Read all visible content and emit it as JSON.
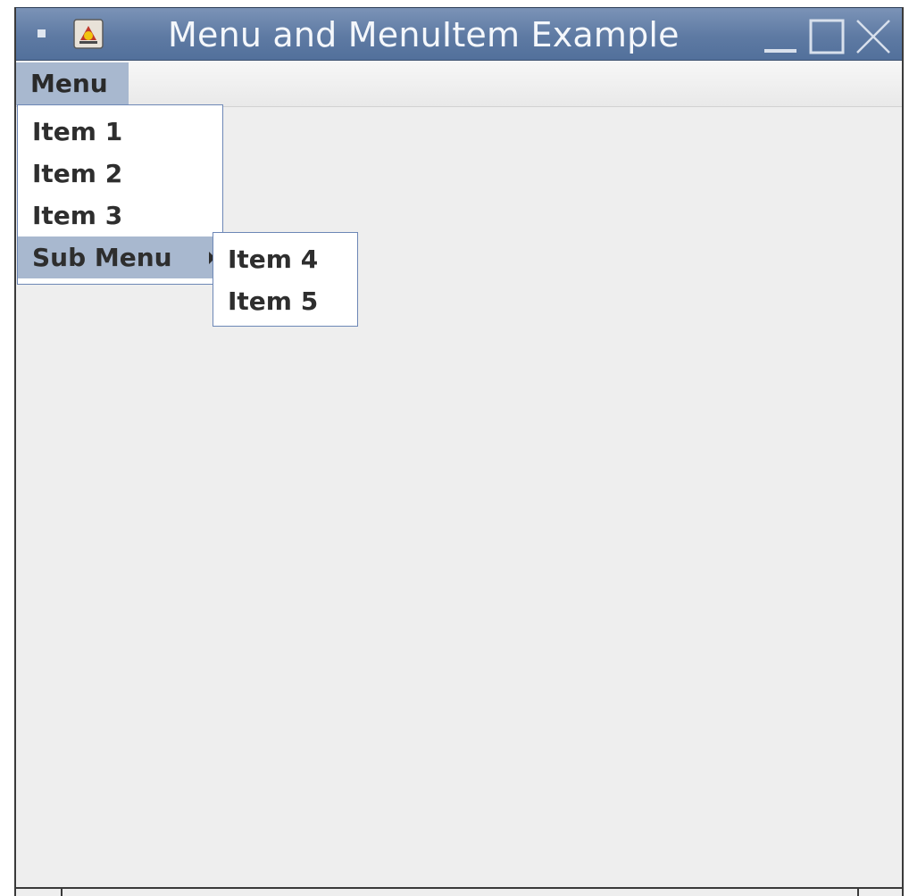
{
  "window": {
    "title": "Menu and MenuItem Example",
    "icon": "java-app-icon",
    "controls": [
      "minimize-icon",
      "maximize-icon",
      "close-icon"
    ]
  },
  "menubar": {
    "menu_label": "Menu"
  },
  "menu_popup": {
    "items": [
      {
        "label": "Item 1"
      },
      {
        "label": "Item 2"
      },
      {
        "label": "Item 3"
      },
      {
        "label": "Sub Menu",
        "selected": true,
        "has_submenu": true
      }
    ]
  },
  "submenu_popup": {
    "items": [
      {
        "label": "Item 4"
      },
      {
        "label": "Item 5"
      }
    ]
  },
  "colors": {
    "titlebar": "#5e7aa3",
    "selection": "#a8b8cf",
    "popup_border": "#6d87b6",
    "content_bg": "#eeeeee"
  }
}
